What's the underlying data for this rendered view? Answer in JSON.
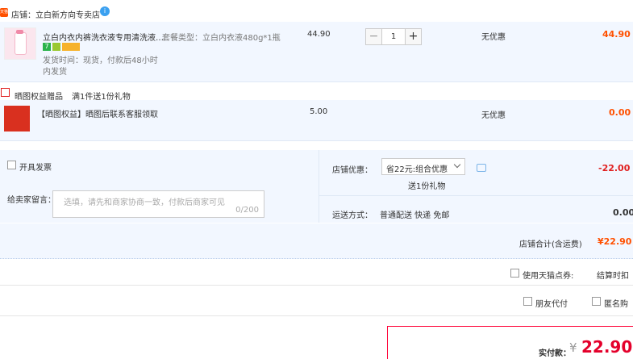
{
  "store": {
    "badge": "天猫",
    "label": "店铺：立白新方向专卖店",
    "info_icon": "i"
  },
  "item1": {
    "title": "立白内衣内裤洗衣液专用清洗液…",
    "spec": "套餐类型：立白内衣液480g*1瓶",
    "price": "44.90",
    "qty": "1",
    "minus": "−",
    "plus": "+",
    "discount": "无优惠",
    "subtotal": "44.90",
    "ship_time": "发货时间：现货，付款后48小时",
    "ship_time2": "内发货",
    "badges": [
      "7",
      "",
      ""
    ]
  },
  "gift_header": {
    "label": "晒图权益赠品",
    "rule": "满1件送1份礼物"
  },
  "item2": {
    "title": "【晒图权益】晒图后联系客服领取",
    "price": "5.00",
    "discount": "无优惠",
    "subtotal": "0.00"
  },
  "invoice": {
    "label": "开具发票"
  },
  "store_discount": {
    "label": "店铺优惠：",
    "select": "省22元:组合优惠",
    "note": "送1份礼物",
    "amount": "-22.00"
  },
  "message": {
    "label": "给卖家留言：",
    "placeholder": "选填，请先和商家协商一致，付款后商家可见",
    "counter": "0/200"
  },
  "shipping": {
    "label": "运送方式：",
    "value": "普通配送 快递 免邮",
    "amount": "0.00"
  },
  "store_total": {
    "label": "店铺合计(含运费)",
    "amount": "¥22.90"
  },
  "points": {
    "label": "使用天猫点券:",
    "extra": "结算时扣"
  },
  "friend_pay": {
    "label": "朋友代付"
  },
  "anonymous": {
    "label": "匿名购"
  },
  "final": {
    "label": "实付款：",
    "currency": "¥",
    "amount": "22.90"
  },
  "colors": {
    "accent": "#ff5000",
    "blue": "#2a6ecf",
    "final_red": "#e4002b",
    "panel_bg": "#f2f7ff",
    "border": "#b9cdea"
  }
}
